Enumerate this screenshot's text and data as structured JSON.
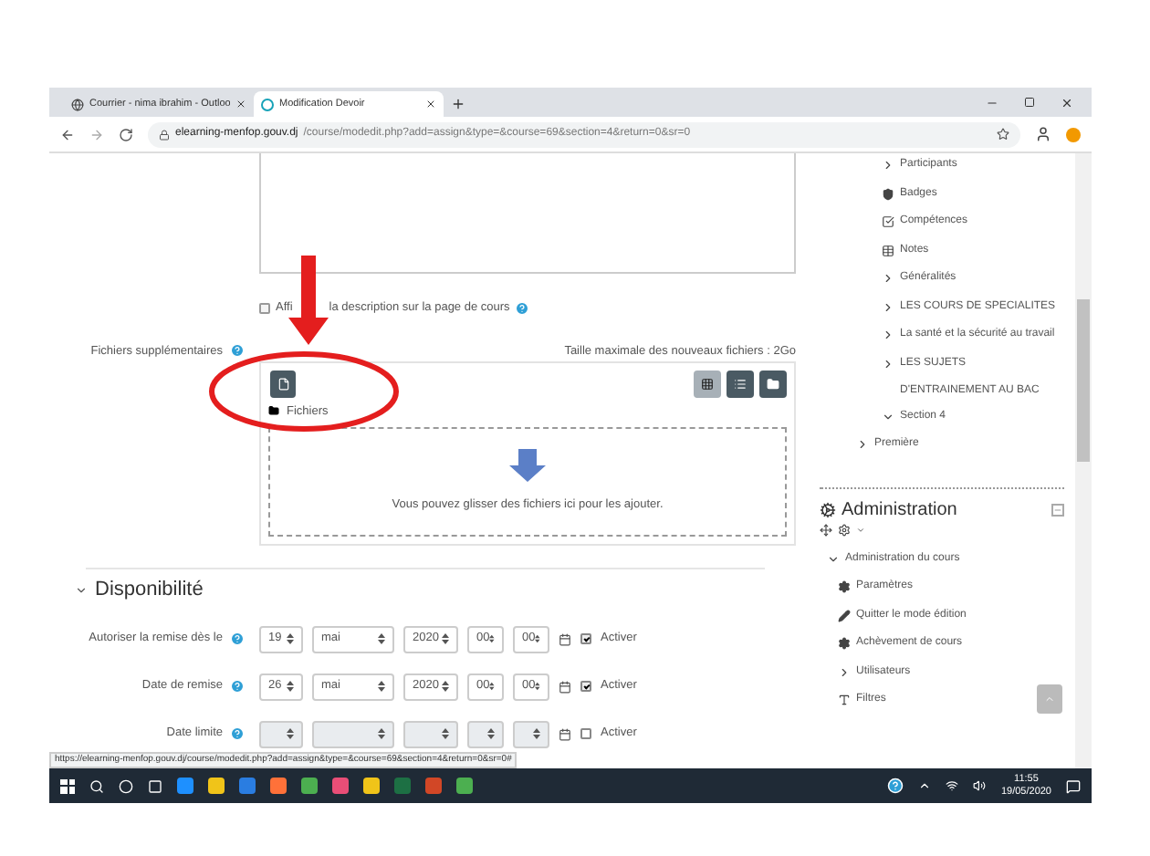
{
  "browser": {
    "tabs": [
      {
        "title": "Courrier - nima ibrahim - Outloo",
        "selected": false
      },
      {
        "title": "Modification Devoir",
        "selected": true
      }
    ],
    "url_host": "elearning-menfop.gouv.dj",
    "url_path": "/course/modedit.php?add=assign&type=&course=69&section=4&return=0&sr=0"
  },
  "form": {
    "show_description": {
      "label_start": "Affi",
      "label_end": "la description sur la page de cours",
      "checked": false
    },
    "files": {
      "label": "Fichiers supplémentaires",
      "max_size": "Taille maximale des nouveaux fichiers : 2Go",
      "path": "Fichiers",
      "drop_hint": "Vous pouvez glisser des fichiers ici pour les ajouter.",
      "views": [
        {
          "kind": "icons",
          "selected": true
        },
        {
          "kind": "list",
          "selected": false
        },
        {
          "kind": "tree",
          "selected": false
        }
      ]
    },
    "section_title": "Disponibilité",
    "dates": [
      {
        "label": "Autoriser la remise dès le",
        "day": "19",
        "month": "mai",
        "year": "2020",
        "hour": "00",
        "minute": "00",
        "enable_label": "Activer",
        "checked": true
      },
      {
        "label": "Date de remise",
        "day": "26",
        "month": "mai",
        "year": "2020",
        "hour": "00",
        "minute": "00",
        "enable_label": "Activer",
        "checked": true
      },
      {
        "label": "Date limite",
        "enable_label": "Activer",
        "checked": false
      }
    ]
  },
  "navigation": [
    {
      "kind": "folder",
      "label": "Participants",
      "expanded": false
    },
    {
      "kind": "shield",
      "label": "Badges"
    },
    {
      "kind": "competency",
      "label": "Compétences"
    },
    {
      "kind": "grades",
      "label": "Notes"
    },
    {
      "kind": "folder",
      "label": "Généralités",
      "expanded": false
    },
    {
      "kind": "folder",
      "label": "LES COURS DE SPECIALITES",
      "expanded": false
    },
    {
      "kind": "folder",
      "label": "La santé et la sécurité au travail",
      "expanded": false
    },
    {
      "kind": "folder",
      "label": "LES SUJETS D'ENTRAINEMENT AU BAC",
      "expanded": false
    },
    {
      "kind": "folder",
      "label": "Section 4",
      "expanded": true
    },
    {
      "kind": "parent",
      "label": "Première",
      "expanded": false
    }
  ],
  "administration": {
    "title": "Administration",
    "items": [
      {
        "kind": "folder",
        "label": "Administration du cours",
        "expanded": true
      },
      {
        "kind": "settings",
        "label": "Paramètres"
      },
      {
        "kind": "edit",
        "label": "Quitter le mode édition"
      },
      {
        "kind": "settings",
        "label": "Achèvement de cours"
      },
      {
        "kind": "folder",
        "label": "Utilisateurs",
        "expanded": false
      },
      {
        "kind": "filter",
        "label": "Filtres"
      }
    ]
  },
  "status_url": "https://elearning-menfop.gouv.dj/course/modedit.php?add=assign&type=&course=69&section=4&return=0&sr=0#",
  "taskbar": {
    "time": "11:55",
    "date": "19/05/2020"
  }
}
